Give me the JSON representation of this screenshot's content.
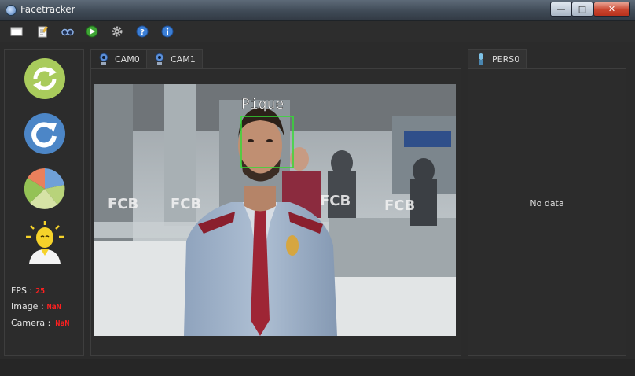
{
  "window": {
    "title": "Facetracker",
    "minimize": "—",
    "maximize": "□",
    "close": "✕"
  },
  "toolbar": {
    "icons": [
      "window-icon",
      "notepad-icon",
      "binoculars-icon",
      "play-icon",
      "gear-icon",
      "help-icon",
      "info-icon"
    ]
  },
  "sidebar": {
    "buttons": [
      "refresh-icon",
      "reload-icon",
      "pie-chart-icon",
      "user-idea-icon"
    ],
    "fps_label": "FPS :",
    "fps_value": "25",
    "image_label": "Image :",
    "image_value": "NaN",
    "camera_label": "Camera :",
    "camera_value": "NaN"
  },
  "camera_tabs": [
    {
      "label": "CAM0",
      "active": false
    },
    {
      "label": "CAM1",
      "active": true
    }
  ],
  "video": {
    "face_label": "Pique",
    "wall_text": "FCB",
    "box_color": "#33dd33"
  },
  "person_tabs": [
    {
      "label": "PERS0",
      "active": true
    }
  ],
  "person_panel": {
    "empty_text": "No data"
  },
  "colors": {
    "background": "#2b2b2b",
    "stat_value": "#ff2020",
    "titlebar_close": "#c9452f"
  }
}
